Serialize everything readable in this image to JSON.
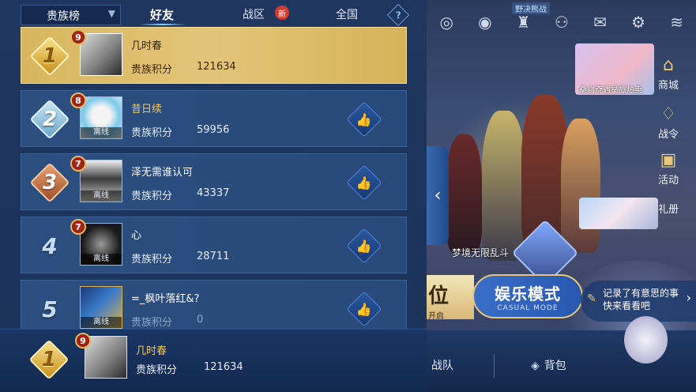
{
  "tabs": {
    "dropdown_label": "贵族榜",
    "friends": "好友",
    "zone": "战区",
    "zone_badge": "新",
    "all": "全国",
    "help": "?"
  },
  "leaderboard": [
    {
      "rank": "1",
      "level": "9",
      "name": "几时春",
      "label": "贵族积分",
      "score": "121634",
      "offline": "",
      "liked": false
    },
    {
      "rank": "2",
      "level": "8",
      "name": "昔日续",
      "label": "贵族积分",
      "score": "59956",
      "offline": "离线",
      "liked": true
    },
    {
      "rank": "3",
      "level": "7",
      "name": "泽无需谁认可",
      "label": "贵族积分",
      "score": "43337",
      "offline": "离线",
      "liked": true
    },
    {
      "rank": "4",
      "level": "7",
      "name": "心",
      "label": "贵族积分",
      "score": "28711",
      "offline": "离线",
      "liked": true
    },
    {
      "rank": "5",
      "level": "",
      "name": "=_枫叶落红&?",
      "label": "贵族积分",
      "score": "0",
      "offline": "离线",
      "liked": true
    }
  ],
  "self": {
    "rank": "1",
    "level": "9",
    "name": "几时春",
    "label": "贵族积分",
    "score": "121634"
  },
  "game": {
    "shop": "商城",
    "pass": "战令",
    "activity": "活动",
    "gift": "礼册",
    "promo1": "桑启奇遇星旅热卖",
    "pvp_label": "野决熊战",
    "dream_mode": "梦境无限乱斗",
    "ranked_char": "位",
    "ranked_sub": "开启",
    "casual_title": "娱乐模式",
    "casual_sub": "CASUAL MODE",
    "record_line1": "记录了有意思的事",
    "record_line2": "快来看看吧",
    "team": "战队",
    "bag": "背包"
  },
  "icons": {
    "like": "thumbs-up-icon",
    "collapse": "chevron-left-icon",
    "dropdown": "chevron-down-icon"
  }
}
